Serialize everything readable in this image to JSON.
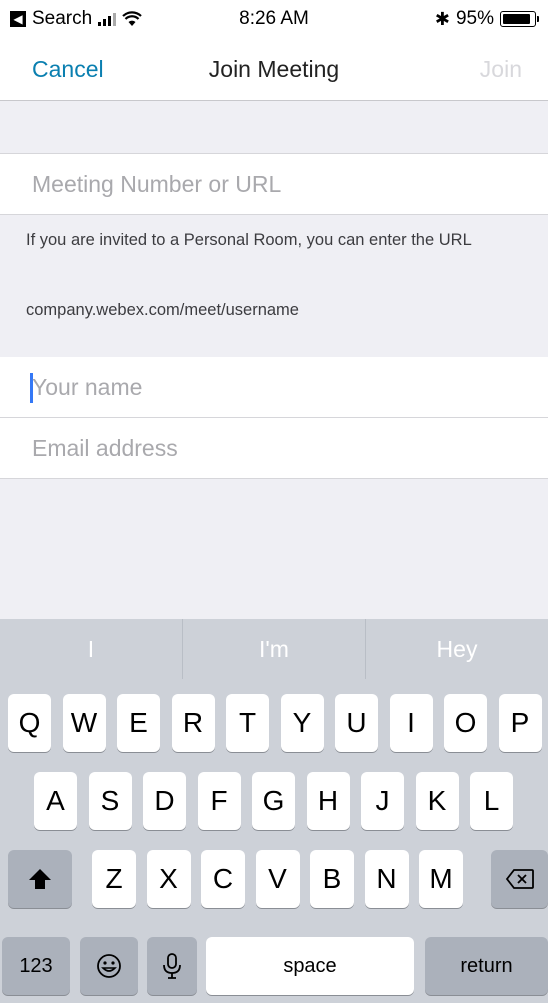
{
  "status_bar": {
    "back_label": "Search",
    "time": "8:26 AM",
    "battery": "95%"
  },
  "nav": {
    "cancel": "Cancel",
    "title": "Join Meeting",
    "join": "Join"
  },
  "form": {
    "meeting_placeholder": "Meeting Number or URL",
    "info_text": "If you are invited to a Personal Room, you can enter the URL",
    "info_example": "company.webex.com/meet/username",
    "name_placeholder": "Your name",
    "email_placeholder": "Email address"
  },
  "keyboard": {
    "suggestions": [
      "I",
      "I'm",
      "Hey"
    ],
    "row1": [
      "Q",
      "W",
      "E",
      "R",
      "T",
      "Y",
      "U",
      "I",
      "O",
      "P"
    ],
    "row2": [
      "A",
      "S",
      "D",
      "F",
      "G",
      "H",
      "J",
      "K",
      "L"
    ],
    "row3": [
      "Z",
      "X",
      "C",
      "V",
      "B",
      "N",
      "M"
    ],
    "numbers_key": "123",
    "space_key": "space",
    "return_key": "return"
  }
}
